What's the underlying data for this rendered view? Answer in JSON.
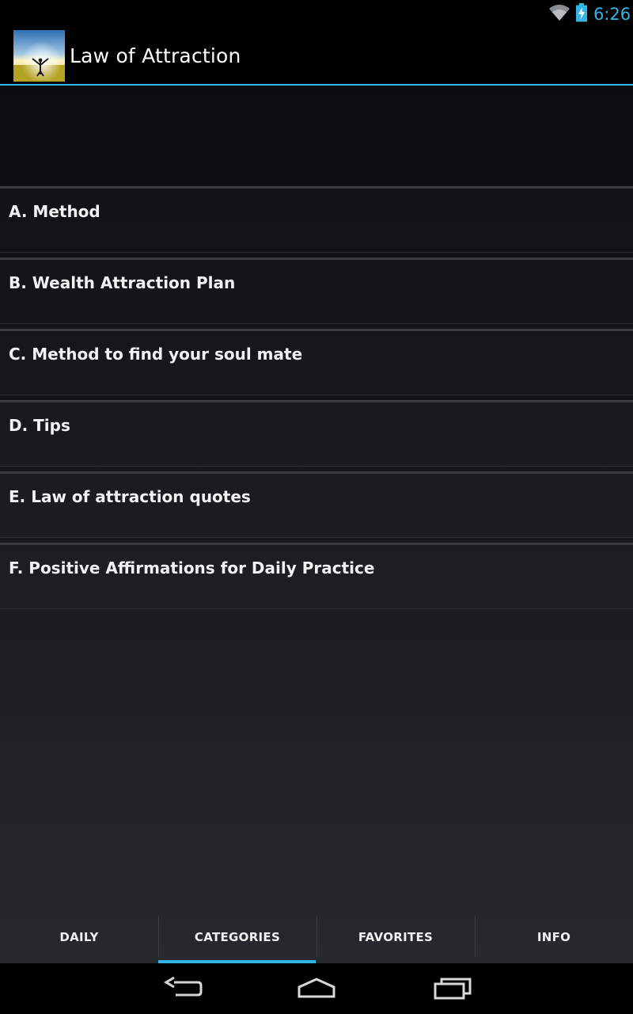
{
  "status_bar": {
    "time": "6:26",
    "icons": [
      "wifi-icon",
      "battery-charging-icon"
    ],
    "accent_color": "#33b5e5"
  },
  "action_bar": {
    "title": "Law of Attraction",
    "icon": "app-logo-icon"
  },
  "categories": [
    {
      "label": "A. Method"
    },
    {
      "label": "B. Wealth Attraction Plan"
    },
    {
      "label": "C. Method to find your soul mate"
    },
    {
      "label": "D. Tips"
    },
    {
      "label": "E. Law of attraction quotes"
    },
    {
      "label": "F. Positive Affirmations for Daily Practice"
    }
  ],
  "tabs": [
    {
      "label": "DAILY",
      "selected": false
    },
    {
      "label": "CATEGORIES",
      "selected": true
    },
    {
      "label": "FAVORITES",
      "selected": false
    },
    {
      "label": "INFO",
      "selected": false
    }
  ],
  "nav_bar": {
    "icons": [
      "back-icon",
      "home-icon",
      "recent-apps-icon"
    ]
  }
}
